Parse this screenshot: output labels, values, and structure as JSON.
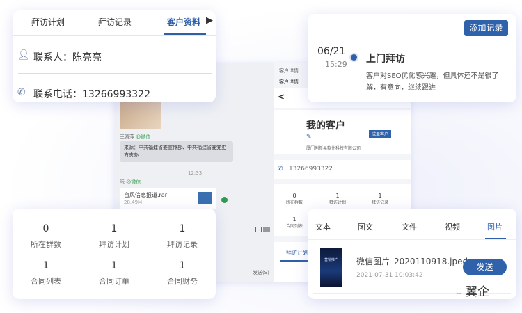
{
  "contact_card": {
    "tabs": [
      "拜访计划",
      "拜访记录",
      "客户资料"
    ],
    "active_tab": 2,
    "contact_label": "联系人：陈亮亮",
    "phone_label": "联系电话：13266993322"
  },
  "visit_card": {
    "add_button": "添加记录",
    "date": "06/21",
    "time": "15:29",
    "title": "上门拜访",
    "desc_line1": "客户对SEO优化感兴趣，但具体还不是很了",
    "desc_line2": "解，有意向，继续跟进"
  },
  "stats_card": {
    "items": [
      {
        "value": "0",
        "label": "所在群数"
      },
      {
        "value": "1",
        "label": "拜访计划"
      },
      {
        "value": "1",
        "label": "拜访记录"
      },
      {
        "value": "1",
        "label": "合同列表"
      },
      {
        "value": "1",
        "label": "合同订单"
      },
      {
        "value": "1",
        "label": "合同财务"
      }
    ]
  },
  "media_card": {
    "tabs": [
      "文本",
      "图文",
      "文件",
      "视频",
      "图片"
    ],
    "active_tab": 4,
    "file_name": "微信图片_2020110918.jped",
    "file_date": "2021-07-31 10:03:42",
    "send_button": "发送",
    "thumb_text": "营销推广"
  },
  "chat": {
    "sender1": "王腾萍",
    "channel1": "@微信",
    "message": "来源：中共福建省委宣传部、中共福建省委党史方志办",
    "time": "12:33",
    "sender2": "阮",
    "channel2": "@微信",
    "file_name": "台风信息报道.rar",
    "file_size": "28.49M",
    "send": "发送(S)"
  },
  "detail": {
    "header1": "客户详情",
    "header2": "客户详情",
    "back": "<",
    "name": "我的客户",
    "badge": "成单客户",
    "company": "厦门创新易软件科技有限公司",
    "phone": "13266993322",
    "stats": [
      {
        "value": "0",
        "label": "所在群数"
      },
      {
        "value": "1",
        "label": "拜访计划"
      },
      {
        "value": "1",
        "label": "拜访记录"
      },
      {
        "value": "1",
        "label": "合同列表"
      }
    ],
    "tab": "拜访计划"
  },
  "watermark": "翼企"
}
